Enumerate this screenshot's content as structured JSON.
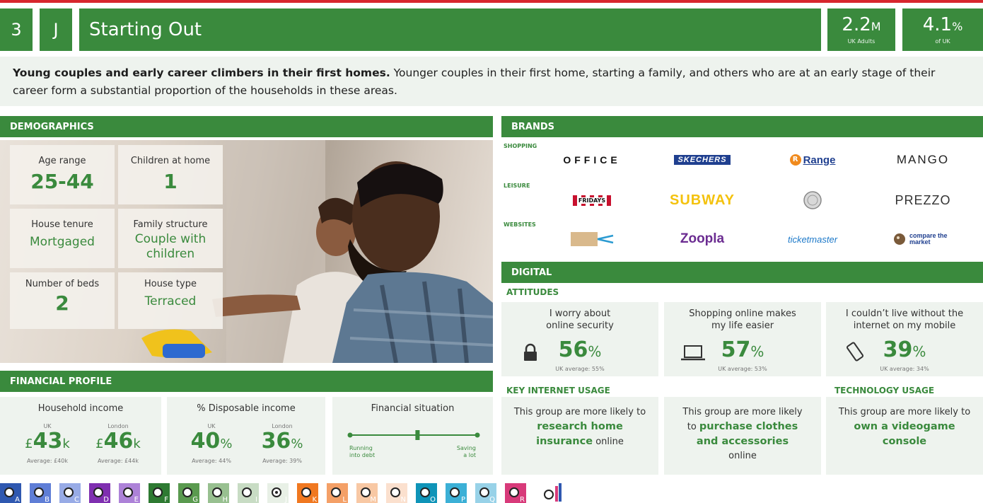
{
  "header": {
    "group_number": "3",
    "type_code": "J",
    "title": "Starting Out",
    "population_value": "2.2",
    "population_unit": "M",
    "population_caption": "UK Adults",
    "share_value": "4.1",
    "share_unit": "%",
    "share_caption": "of UK"
  },
  "intro": {
    "bold_lead": "Young couples and early career climbers in their first homes.",
    "text": " Younger couples in their first home, starting a family, and others who are at an early stage of their career form a substantial proportion of the households in these areas."
  },
  "demographics": {
    "heading": "DEMOGRAPHICS",
    "tiles": [
      {
        "label": "Age range",
        "value": "25-44"
      },
      {
        "label": "Children at home",
        "value": "1"
      },
      {
        "label": "House tenure",
        "value": "Mortgaged"
      },
      {
        "label": "Family structure",
        "value": "Couple with children"
      },
      {
        "label": "Number of beds",
        "value": "2"
      },
      {
        "label": "House type",
        "value": "Terraced"
      }
    ]
  },
  "financial": {
    "heading": "FINANCIAL PROFILE",
    "income": {
      "title": "Household income",
      "uk_label": "UK",
      "uk_currency": "£",
      "uk_value": "43",
      "uk_unit": "k",
      "uk_avg": "Average: £40k",
      "london_label": "London",
      "london_currency": "£",
      "london_value": "46",
      "london_unit": "k",
      "london_avg": "Average: £44k"
    },
    "disposable": {
      "title": "% Disposable income",
      "uk_label": "UK",
      "uk_value": "40",
      "uk_unit": "%",
      "uk_avg": "Average: 44%",
      "london_label": "London",
      "london_value": "36",
      "london_unit": "%",
      "london_avg": "Average: 39%"
    },
    "situation": {
      "title": "Financial situation",
      "left_label_1": "Running",
      "left_label_2": "into debt",
      "right_label_1": "Saving",
      "right_label_2": "a lot",
      "position": 0.53
    }
  },
  "brands": {
    "heading": "BRANDS",
    "rows": [
      {
        "label": "SHOPPING",
        "items": [
          "OFFICE",
          "SKECHERS",
          "Range",
          "MANGO"
        ]
      },
      {
        "label": "LEISURE",
        "items": [
          "FRIDAYS",
          "SUBWAY",
          "PIZZA EXPRESS",
          "PREZZO"
        ]
      },
      {
        "label": "WEBSITES",
        "items": [
          "NOT ON THE HIGH STREET",
          "Zoopla",
          "ticketmaster",
          "compare the market"
        ]
      }
    ]
  },
  "digital": {
    "heading": "DIGITAL",
    "attitudes_heading": "ATTITUDES",
    "attitudes": [
      {
        "line1": "I worry about",
        "line2": "online security",
        "value": "56",
        "unit": "%",
        "uk_avg": "UK average: 55%",
        "icon": "lock-icon"
      },
      {
        "line1": "Shopping online makes",
        "line2": "my life easier",
        "value": "57",
        "unit": "%",
        "uk_avg": "UK average: 53%",
        "icon": "laptop-icon"
      },
      {
        "line1": "I couldn’t live without the",
        "line2": "internet on my mobile",
        "value": "39",
        "unit": "%",
        "uk_avg": "UK average: 34%",
        "icon": "mobile-phone-icon"
      }
    ],
    "key_usage_heading": "KEY INTERNET USAGE",
    "tech_usage_heading": "TECHNOLOGY USAGE",
    "usage": [
      {
        "pre": "This group are more likely to",
        "highlight": "research home insurance",
        "post": " online"
      },
      {
        "pre": "This group are more likely to ",
        "highlight": "purchase clothes and accessories",
        "post": " online"
      },
      {
        "pre": "This group are more likely to ",
        "highlight": "own a videogame console",
        "post": ""
      }
    ]
  },
  "groups": {
    "items": [
      {
        "letter": "A",
        "color": "#2f58b0"
      },
      {
        "letter": "B",
        "color": "#5f7ed6"
      },
      {
        "letter": "C",
        "color": "#98abe6"
      },
      {
        "letter": "D",
        "color": "#7f2fb0"
      },
      {
        "letter": "E",
        "color": "#ad82d8"
      },
      {
        "letter": "F",
        "color": "#2e7a32"
      },
      {
        "letter": "G",
        "color": "#5a9a4f"
      },
      {
        "letter": "H",
        "color": "#98c090"
      },
      {
        "letter": "I",
        "color": "#c8dcc4"
      },
      {
        "letter": "J",
        "color": "#e8f0e6"
      },
      {
        "letter": "K",
        "color": "#f07820"
      },
      {
        "letter": "L",
        "color": "#f4a067"
      },
      {
        "letter": "M",
        "color": "#f8c8a4"
      },
      {
        "letter": "N",
        "color": "#fbe0ce"
      },
      {
        "letter": "O",
        "color": "#0f94b8"
      },
      {
        "letter": "P",
        "color": "#3cb0d6"
      },
      {
        "letter": "Q",
        "color": "#98d2e8"
      },
      {
        "letter": "R",
        "color": "#d83a7a"
      }
    ],
    "selected": "J"
  },
  "colors": {
    "brand_green": "#3a8a3d",
    "panel_bg": "#eef3ee",
    "top_rule": "#d7262e"
  }
}
